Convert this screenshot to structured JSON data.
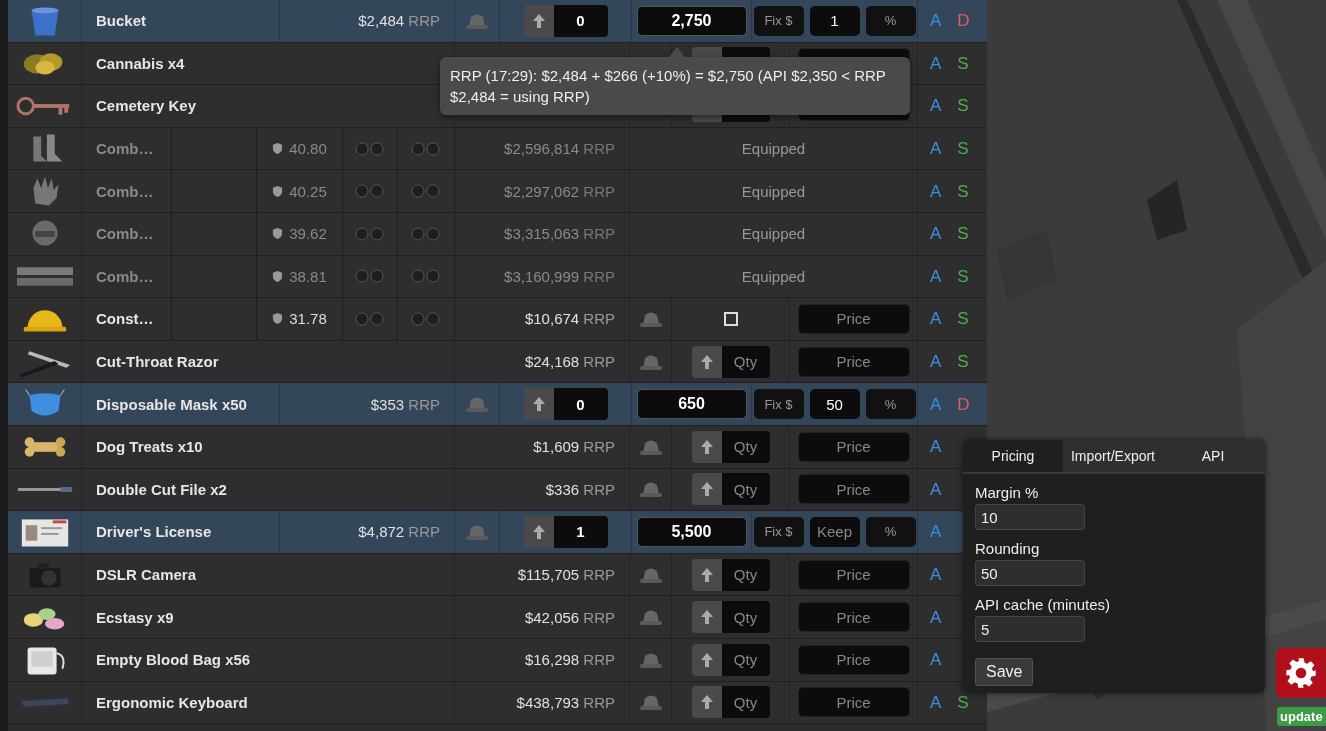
{
  "rows": [
    {
      "kind": "listed",
      "name": "Bucket",
      "price": "$2,484",
      "price_unit": "RRP",
      "qty": "0",
      "sell_price": "2,750",
      "fix_label": "Fix $",
      "amount": "1",
      "percent_label": "%",
      "actions": [
        {
          "label": "A",
          "kind": "add"
        },
        {
          "label": "D",
          "kind": "delete"
        }
      ]
    },
    {
      "kind": "plain",
      "name": "Cannabis x4",
      "actions": [
        {
          "label": "A",
          "kind": "add"
        },
        {
          "label": "S",
          "kind": "sell"
        }
      ]
    },
    {
      "kind": "plain",
      "name": "Cemetery Key",
      "actions": [
        {
          "label": "A",
          "kind": "add"
        },
        {
          "label": "S",
          "kind": "sell"
        }
      ]
    },
    {
      "kind": "equipped",
      "name": "Comb…",
      "armor": "40.80",
      "price": "$2,596,814",
      "price_unit": "RRP",
      "status": "Equipped",
      "actions": [
        {
          "label": "A",
          "kind": "add"
        },
        {
          "label": "S",
          "kind": "sell"
        }
      ]
    },
    {
      "kind": "equipped",
      "name": "Comb…",
      "armor": "40.25",
      "price": "$2,297,062",
      "price_unit": "RRP",
      "status": "Equipped",
      "actions": [
        {
          "label": "A",
          "kind": "add"
        },
        {
          "label": "S",
          "kind": "sell"
        }
      ]
    },
    {
      "kind": "equipped",
      "name": "Comb…",
      "armor": "39.62",
      "price": "$3,315,063",
      "price_unit": "RRP",
      "status": "Equipped",
      "actions": [
        {
          "label": "A",
          "kind": "add"
        },
        {
          "label": "S",
          "kind": "sell"
        }
      ]
    },
    {
      "kind": "equipped",
      "name": "Comb…",
      "armor": "38.81",
      "price": "$3,160,999",
      "price_unit": "RRP",
      "status": "Equipped",
      "actions": [
        {
          "label": "A",
          "kind": "add"
        },
        {
          "label": "S",
          "kind": "sell"
        }
      ]
    },
    {
      "kind": "armor",
      "name": "Const…",
      "armor": "31.78",
      "price": "$10,674",
      "price_unit": "RRP",
      "checked": false,
      "price_placeholder": "Price",
      "actions": [
        {
          "label": "A",
          "kind": "add"
        },
        {
          "label": "S",
          "kind": "sell"
        }
      ]
    },
    {
      "kind": "plain",
      "name": "Cut-Throat Razor",
      "price": "$24,168",
      "price_unit": "RRP",
      "qty_placeholder": "Qty",
      "price_placeholder": "Price",
      "actions": [
        {
          "label": "A",
          "kind": "add"
        },
        {
          "label": "S",
          "kind": "sell"
        }
      ]
    },
    {
      "kind": "listed",
      "name": "Disposable Mask x50",
      "price": "$353",
      "price_unit": "RRP",
      "qty": "0",
      "sell_price": "650",
      "fix_label": "Fix $",
      "amount": "50",
      "percent_label": "%",
      "actions": [
        {
          "label": "A",
          "kind": "add"
        },
        {
          "label": "D",
          "kind": "delete"
        }
      ]
    },
    {
      "kind": "plain",
      "name": "Dog Treats x10",
      "price": "$1,609",
      "price_unit": "RRP",
      "qty_placeholder": "Qty",
      "price_placeholder": "Price",
      "actions": [
        {
          "label": "A",
          "kind": "add"
        }
      ]
    },
    {
      "kind": "plain",
      "name": "Double Cut File x2",
      "price": "$336",
      "price_unit": "RRP",
      "qty_placeholder": "Qty",
      "price_placeholder": "Price",
      "actions": [
        {
          "label": "A",
          "kind": "add"
        }
      ]
    },
    {
      "kind": "listed",
      "name": "Driver's License",
      "price": "$4,872",
      "price_unit": "RRP",
      "qty": "1",
      "sell_price": "5,500",
      "fix_label": "Fix $",
      "amount_placeholder": "Keep",
      "percent_label": "%",
      "actions": [
        {
          "label": "A",
          "kind": "add"
        }
      ]
    },
    {
      "kind": "plain",
      "name": "DSLR Camera",
      "price": "$115,705",
      "price_unit": "RRP",
      "qty_placeholder": "Qty",
      "price_placeholder": "Price",
      "actions": [
        {
          "label": "A",
          "kind": "add"
        }
      ]
    },
    {
      "kind": "plain",
      "name": "Ecstasy x9",
      "price": "$42,056",
      "price_unit": "RRP",
      "qty_placeholder": "Qty",
      "price_placeholder": "Price",
      "actions": [
        {
          "label": "A",
          "kind": "add"
        }
      ]
    },
    {
      "kind": "plain",
      "name": "Empty Blood Bag x56",
      "price": "$16,298",
      "price_unit": "RRP",
      "qty_placeholder": "Qty",
      "price_placeholder": "Price",
      "actions": [
        {
          "label": "A",
          "kind": "add"
        }
      ]
    },
    {
      "kind": "plain",
      "name": "Ergonomic Keyboard",
      "price": "$438,793",
      "price_unit": "RRP",
      "qty_placeholder": "Qty",
      "price_placeholder": "Price",
      "actions": [
        {
          "label": "A",
          "kind": "add"
        },
        {
          "label": "S",
          "kind": "sell"
        }
      ]
    }
  ],
  "tooltip": {
    "text": "RRP (17:29): $2,484 + $266 (+10%) = $2,750 (API $2,350 < RRP $2,484 = using RRP)"
  },
  "settings": {
    "tabs": [
      {
        "label": "Pricing",
        "selected": true
      },
      {
        "label": "Import/Export",
        "selected": false
      },
      {
        "label": "API",
        "selected": false
      }
    ],
    "fields": [
      {
        "label": "Margin %",
        "value": "10"
      },
      {
        "label": "Rounding",
        "value": "50"
      },
      {
        "label": "API cache (minutes)",
        "value": "5"
      }
    ],
    "save_label": "Save"
  },
  "update_badge": "update"
}
